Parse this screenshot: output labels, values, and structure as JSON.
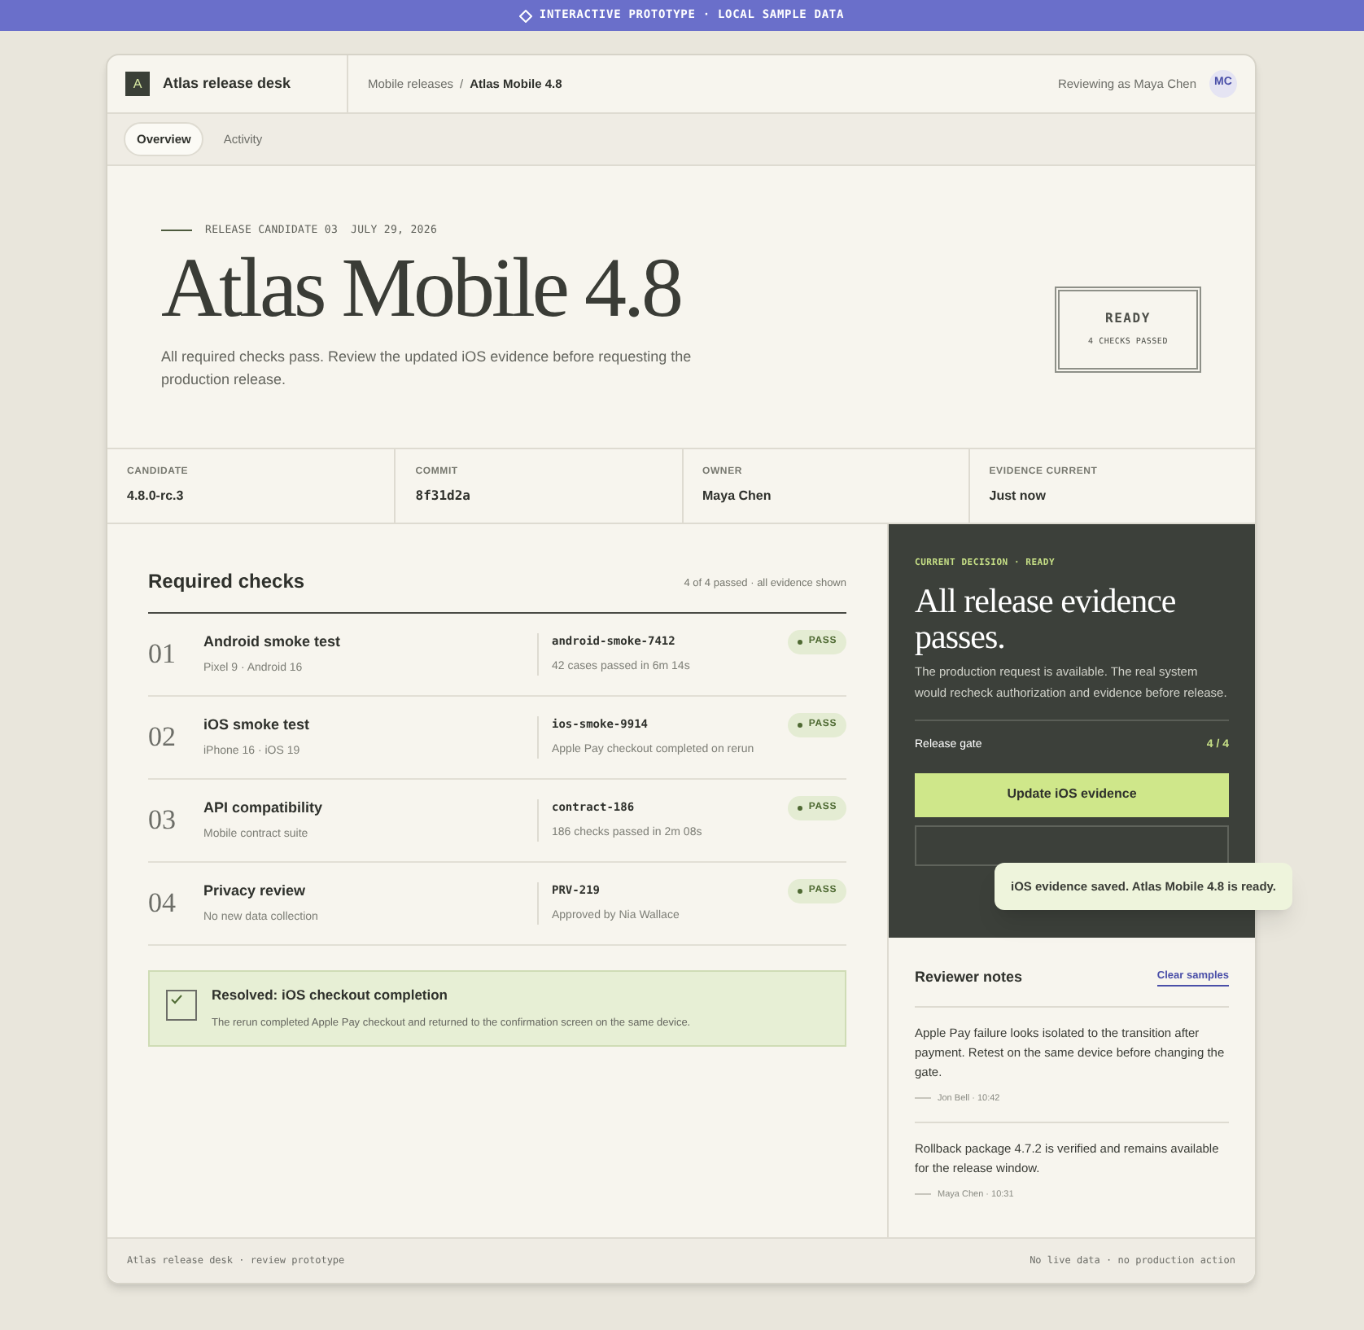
{
  "banner": {
    "text": "INTERACTIVE PROTOTYPE · LOCAL SAMPLE DATA"
  },
  "header": {
    "logo_letter": "A",
    "app_name": "Atlas release desk",
    "breadcrumb_parent": "Mobile releases",
    "breadcrumb_separator": "/",
    "breadcrumb_current": "Atlas Mobile 4.8",
    "reviewer": "Reviewing as Maya Chen",
    "avatar": "MC"
  },
  "tabs": [
    {
      "label": "Overview",
      "selected": true
    },
    {
      "label": "Activity",
      "selected": false
    }
  ],
  "hero": {
    "eyebrow": "RELEASE CANDIDATE 03",
    "date": "JULY 29, 2026",
    "title": "Atlas Mobile 4.8",
    "description": "All required checks pass. Review the updated iOS evidence before requesting the production release.",
    "stamp_label": "READY",
    "stamp_sub": "4 CHECKS PASSED"
  },
  "meta": [
    {
      "label": "CANDIDATE",
      "value": "4.8.0-rc.3",
      "kind": "text"
    },
    {
      "label": "COMMIT",
      "value": "8f31d2a",
      "kind": "mono"
    },
    {
      "label": "OWNER",
      "value": "Maya Chen",
      "kind": "text"
    },
    {
      "label": "EVIDENCE CURRENT",
      "value": "Just now",
      "kind": "text"
    }
  ],
  "checks": {
    "title": "Required checks",
    "summary": "4 of 4 passed · all evidence shown",
    "items": [
      {
        "number": "01",
        "name": "Android smoke test",
        "detail": "Pixel 9 · Android 16",
        "ref": "android-smoke-7412",
        "evidence": "42 cases passed in 6m 14s",
        "status": "PASS"
      },
      {
        "number": "02",
        "name": "iOS smoke test",
        "detail": "iPhone 16 · iOS 19",
        "ref": "ios-smoke-9914",
        "evidence": "Apple Pay checkout completed on rerun",
        "status": "PASS"
      },
      {
        "number": "03",
        "name": "API compatibility",
        "detail": "Mobile contract suite",
        "ref": "contract-186",
        "evidence": "186 checks passed in 2m 08s",
        "status": "PASS"
      },
      {
        "number": "04",
        "name": "Privacy review",
        "detail": "No new data collection",
        "ref": "PRV-219",
        "evidence": "Approved by Nia Wallace",
        "status": "PASS"
      }
    ]
  },
  "resolved": {
    "checked": true,
    "title": "Resolved: iOS checkout completion",
    "text": "The rerun completed Apple Pay checkout and returned to the confirmation screen on the same device."
  },
  "decision": {
    "eyebrow": "CURRENT DECISION · READY",
    "title": "All release evidence passes.",
    "text": "The production request is available. The real system would recheck authorization and evidence before release.",
    "gate_label": "Release gate",
    "gate_value": "4 / 4",
    "primary_button": "Update iOS evidence",
    "toast": "iOS evidence saved. Atlas Mobile 4.8 is ready."
  },
  "notes": {
    "title": "Reviewer notes",
    "action": "Clear samples",
    "items": [
      {
        "text": "Apple Pay failure looks isolated to the transition after payment. Retest on the same device before changing the gate.",
        "byline": "Jon Bell · 10:42"
      },
      {
        "text": "Rollback package 4.7.2 is verified and remains available for the release window.",
        "byline": "Maya Chen · 10:31"
      }
    ]
  },
  "footer": {
    "left": "Atlas release desk · review prototype",
    "right": "No live data · no production action"
  }
}
